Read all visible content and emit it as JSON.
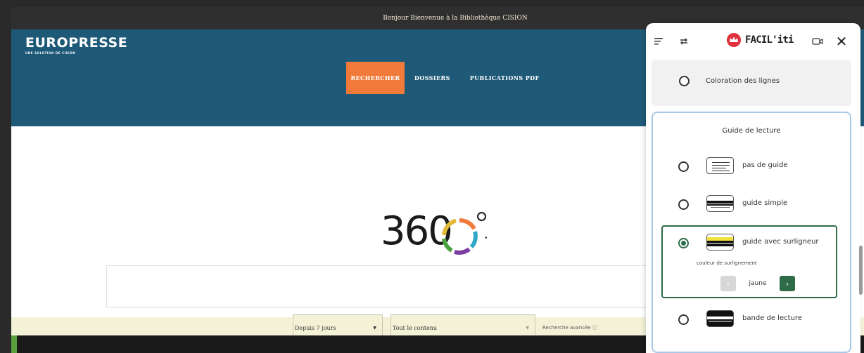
{
  "site": {
    "top_banner": "Bonjour Bienvenue à la Bibliothèque CISION",
    "logo": {
      "brand": "EUROPRESSE",
      "tagline": "UNE SOLUTION DE CISION"
    },
    "nav": [
      {
        "label": "RECHERCHER",
        "active": true
      },
      {
        "label": "DOSSIERS",
        "active": false
      },
      {
        "label": "PUBLICATIONS PDF",
        "active": false
      }
    ],
    "logo360": {
      "text": "360"
    },
    "search": {
      "placeholder": ""
    },
    "filters": {
      "period": "Depuis 7 jours",
      "content": "Tout le contenu",
      "advanced_search": "Recherche avancée ⓘ"
    },
    "colors": {
      "header": "#1e5a78",
      "accent": "#f07a3a",
      "filter_bar": "#f4f2d6"
    }
  },
  "panel": {
    "brand": "FACIL'iti",
    "coloration_option": {
      "label": "Coloration des lignes",
      "selected": false
    },
    "guide": {
      "title": "Guide de lecture",
      "options": [
        {
          "label": "pas de guide",
          "selected": false,
          "icon": "no-guide-icon"
        },
        {
          "label": "guide simple",
          "selected": false,
          "icon": "simple-guide-icon"
        },
        {
          "label": "guide avec surligneur",
          "selected": true,
          "icon": "highlight-guide-icon"
        },
        {
          "label": "bande de lecture",
          "selected": false,
          "icon": "reading-band-icon"
        }
      ],
      "highlight_color": {
        "label": "couleur de surlignement",
        "value": "jaune"
      }
    },
    "colors": {
      "accent": "#2e6b48",
      "section_border": "#a9c7e6",
      "brand_red": "#e0313c"
    }
  }
}
